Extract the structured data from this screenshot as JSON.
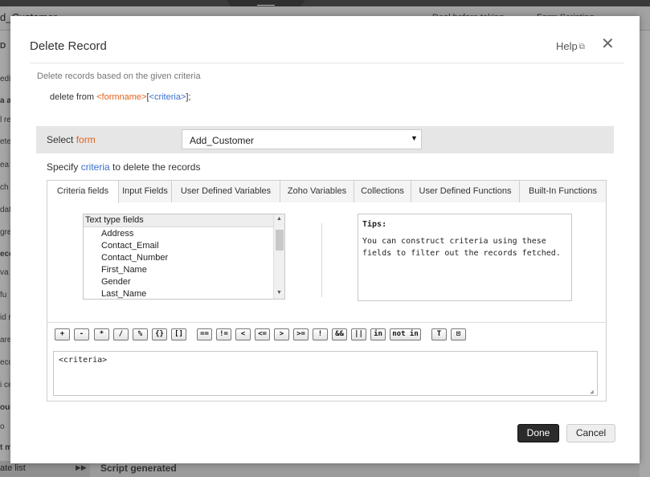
{
  "background": {
    "form_title": "d_Customer",
    "bar_right_1": "Deal before taking",
    "bar_right_2": "Form Scripting",
    "sidebar_fragments": [
      "D",
      "edit",
      "a a",
      "l re",
      "ete",
      "ea",
      "ch",
      "date",
      "gre",
      "ece",
      "va",
      "fu",
      "id r",
      "are",
      "ecc",
      "i ce",
      "oug",
      "o",
      "t m"
    ],
    "bottom_left_label": "ate list",
    "bottom_text": "Script generated"
  },
  "dialog": {
    "title": "Delete Record",
    "help_label": "Help",
    "description": "Delete records based on the given criteria",
    "syntax": {
      "prefix": "delete from ",
      "formname": "<formname>",
      "open_bracket": "[",
      "criteria": "<criteria>",
      "suffix": "];"
    },
    "select_form": {
      "label": "Select ",
      "label_highlight": "form",
      "selected_value": "Add_Customer"
    },
    "specify": {
      "prefix": "Specify ",
      "highlight": "criteria",
      "suffix": " to delete the records"
    },
    "tabs": [
      {
        "label": "Criteria fields",
        "active": true
      },
      {
        "label": "Input Fields",
        "active": false
      },
      {
        "label": "User Defined Variables",
        "active": false
      },
      {
        "label": "Zoho Variables",
        "active": false
      },
      {
        "label": "Collections",
        "active": false
      },
      {
        "label": "User Defined Functions",
        "active": false
      },
      {
        "label": "Built-In Functions",
        "active": false
      }
    ],
    "fields_list": {
      "header": "Text type fields",
      "items": [
        "Address",
        "Contact_Email",
        "Contact_Number",
        "First_Name",
        "Gender",
        "Last_Name"
      ]
    },
    "tips": {
      "title": "Tips:",
      "text": "You can construct criteria using these fields to filter out the records fetched."
    },
    "operators": [
      "+",
      "-",
      "*",
      "/",
      "%",
      "{}",
      "[]",
      "==",
      "!=",
      "<",
      "<=",
      ">",
      ">=",
      "!",
      "&&",
      "||",
      "in",
      "not in",
      "T",
      "⊡"
    ],
    "criteria_text": "<criteria>",
    "buttons": {
      "done": "Done",
      "cancel": "Cancel"
    }
  },
  "colors": {
    "accent_orange": "#e2621d",
    "accent_blue": "#3a6fcf",
    "done_button": "#2b2b2b"
  }
}
